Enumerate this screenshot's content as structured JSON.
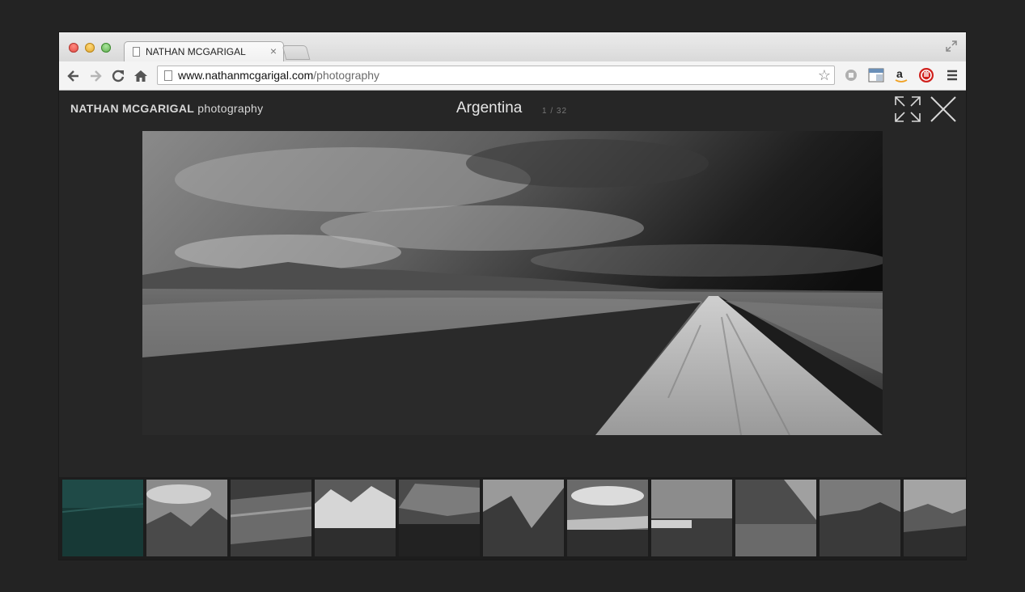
{
  "browser": {
    "tab_title": "NATHAN MCGARIGAL",
    "tab_close": "×",
    "url_domain": "www.nathanmcgarigal.com",
    "url_path": "/photography",
    "bookmark_star": "☆"
  },
  "site": {
    "brand_name": "NATHAN MCGARIGAL",
    "brand_section": "photography",
    "gallery_title": "Argentina",
    "counter": "1 / 32"
  },
  "colors": {
    "page_background": "#262626",
    "active_thumb_tint": "#1f4a47"
  },
  "icons": [
    "back-arrow-icon",
    "forward-arrow-icon",
    "reload-icon",
    "home-icon",
    "bookmark-star-icon",
    "evernote-icon",
    "extension-icon",
    "amazon-icon",
    "adblock-icon",
    "menu-icon",
    "expand-icon",
    "close-icon"
  ],
  "thumbnails": [
    {
      "label": "thumb-1",
      "active": true
    },
    {
      "label": "thumb-2",
      "active": false
    },
    {
      "label": "thumb-3",
      "active": false
    },
    {
      "label": "thumb-4",
      "active": false
    },
    {
      "label": "thumb-5",
      "active": false
    },
    {
      "label": "thumb-6",
      "active": false
    },
    {
      "label": "thumb-7",
      "active": false
    },
    {
      "label": "thumb-8",
      "active": false
    },
    {
      "label": "thumb-9",
      "active": false
    },
    {
      "label": "thumb-10",
      "active": false
    },
    {
      "label": "thumb-11",
      "active": false
    }
  ]
}
